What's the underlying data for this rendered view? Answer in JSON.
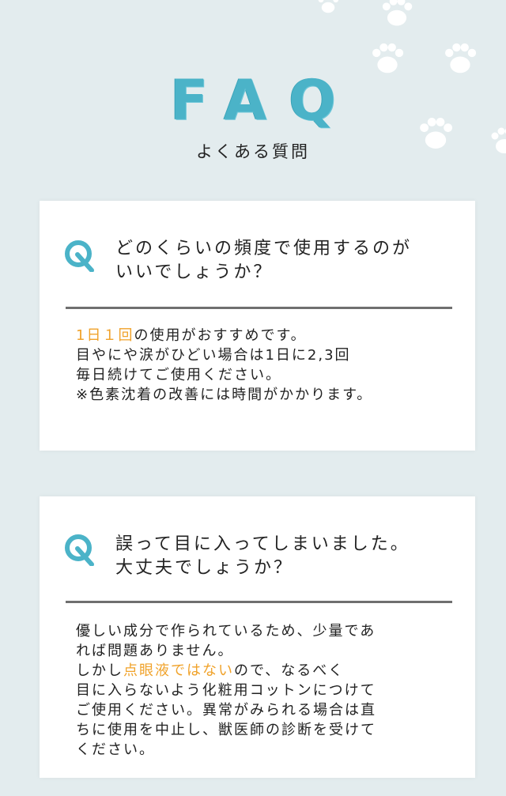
{
  "header": {
    "title": "FAQ",
    "subtitle": "よくある質問"
  },
  "colors": {
    "background": "#e3ecee",
    "accent": "#4bb3c8",
    "highlight": "#f0a22a",
    "divider": "#6f6f6f"
  },
  "faq": [
    {
      "question_line1": "どのくらいの頻度で使用するのが",
      "question_line2": "いいでしょうか？",
      "answer": {
        "line1_highlight": "1日１回",
        "line1_rest": "の使用がおすすめです。",
        "line2": "目やにや涙がひどい場合は1日に2,3回",
        "line3": "毎日続けてご使用ください。",
        "line4": "※色素沈着の改善には時間がかかります。"
      }
    },
    {
      "question_line1": "誤って目に入ってしまいました。",
      "question_line2": "大丈夫でしょうか？",
      "answer": {
        "line1": "優しい成分で作られているため、少量であ",
        "line2": "れば問題ありません。",
        "line3_pre": "しかし",
        "line3_highlight": "点眼液ではない",
        "line3_post": "ので、なるべく",
        "line4": "目に入らないよう化粧用コットンにつけて",
        "line5": "ご使用ください。異常がみられる場合は直",
        "line6": "ちに使用を中止し、獣医師の診断を受けて",
        "line7": "ください。"
      }
    }
  ]
}
